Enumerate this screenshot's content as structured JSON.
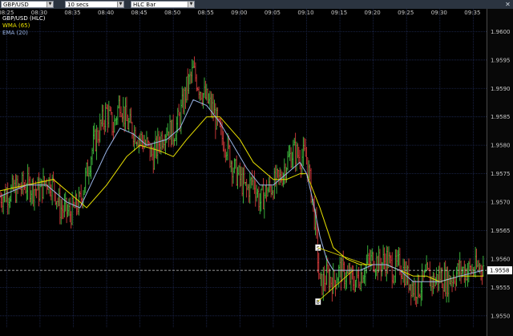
{
  "toolbar": {
    "symbol": "GBP/USD",
    "interval": "10 secs",
    "chart_style": "HLC Bar"
  },
  "colors": {
    "background": "#000000",
    "grid": "#1f2a55",
    "up": "#3fbf3f",
    "down": "#d23a3a",
    "wma": "#e8e000",
    "ema": "#9bb6e8",
    "axis_text": "#c8c8c8",
    "price_line": "#c8c8c8"
  },
  "chart_data": {
    "type": "line",
    "legend": [
      {
        "label": "GBP/USD (HLC)",
        "color": "#ffffff"
      },
      {
        "label": "WMA (65)",
        "color": "#e8e000"
      },
      {
        "label": "EMA (20)",
        "color": "#9bb6e8"
      }
    ],
    "time_ticks": [
      "08:25",
      "08:30",
      "08:35",
      "08:40",
      "08:45",
      "08:50",
      "08:55",
      "09:00",
      "09:05",
      "09:10",
      "09:15",
      "09:20",
      "09:25",
      "09:30",
      "09:35"
    ],
    "price_ticks": [
      "1.9600",
      "1.9595",
      "1.9590",
      "1.9585",
      "1.9580",
      "1.9575",
      "1.9570",
      "1.9565",
      "1.9560",
      "1.9555",
      "1.9550"
    ],
    "ylim": [
      1.9548,
      1.9604
    ],
    "current_price": 1.9558,
    "current_price_label": "1.9558",
    "grid": true,
    "markers": [
      {
        "label": "S",
        "time": "09:11:40",
        "price": 1.9562
      },
      {
        "label": "B",
        "time": "09:11:40",
        "price": 1.95525
      }
    ],
    "price_path": [
      [
        "08:24:00",
        1.9571
      ],
      [
        "08:26:00",
        1.9572
      ],
      [
        "08:28:00",
        1.9573
      ],
      [
        "08:30:00",
        1.9572
      ],
      [
        "08:31:00",
        1.9574
      ],
      [
        "08:32:00",
        1.9573
      ],
      [
        "08:33:00",
        1.9569
      ],
      [
        "08:34:30",
        1.9568
      ],
      [
        "08:36:00",
        1.957
      ],
      [
        "08:37:00",
        1.9575
      ],
      [
        "08:38:00",
        1.958
      ],
      [
        "08:39:00",
        1.9583
      ],
      [
        "08:40:00",
        1.9586
      ],
      [
        "08:41:00",
        1.9583
      ],
      [
        "08:42:00",
        1.9588
      ],
      [
        "08:43:00",
        1.9584
      ],
      [
        "08:44:30",
        1.9582
      ],
      [
        "08:46:00",
        1.958
      ],
      [
        "08:47:00",
        1.9578
      ],
      [
        "08:48:00",
        1.9581
      ],
      [
        "08:49:00",
        1.9583
      ],
      [
        "08:50:00",
        1.9582
      ],
      [
        "08:51:00",
        1.9585
      ],
      [
        "08:52:00",
        1.959
      ],
      [
        "08:53:00",
        1.9593
      ],
      [
        "08:54:00",
        1.959
      ],
      [
        "08:55:00",
        1.9588
      ],
      [
        "08:56:00",
        1.9586
      ],
      [
        "08:57:00",
        1.9582
      ],
      [
        "08:58:00",
        1.958
      ],
      [
        "08:59:00",
        1.9576
      ],
      [
        "09:00:00",
        1.9574
      ],
      [
        "09:01:00",
        1.9572
      ],
      [
        "09:02:00",
        1.9574
      ],
      [
        "09:03:00",
        1.957
      ],
      [
        "09:04:00",
        1.9572
      ],
      [
        "09:05:00",
        1.9573
      ],
      [
        "09:06:00",
        1.9574
      ],
      [
        "09:07:00",
        1.9577
      ],
      [
        "09:08:00",
        1.9579
      ],
      [
        "09:09:00",
        1.9578
      ],
      [
        "09:10:00",
        1.9578
      ],
      [
        "09:10:40",
        1.9572
      ],
      [
        "09:11:20",
        1.9566
      ],
      [
        "09:12:00",
        1.9555
      ],
      [
        "09:13:00",
        1.9557
      ],
      [
        "09:14:00",
        1.9556
      ],
      [
        "09:15:00",
        1.9558
      ],
      [
        "09:16:00",
        1.9557
      ],
      [
        "09:17:00",
        1.9556
      ],
      [
        "09:18:00",
        1.9557
      ],
      [
        "09:19:00",
        1.9559
      ],
      [
        "09:20:00",
        1.956
      ],
      [
        "09:21:00",
        1.9559
      ],
      [
        "09:22:00",
        1.956
      ],
      [
        "09:23:00",
        1.9558
      ],
      [
        "09:24:00",
        1.9559
      ],
      [
        "09:25:00",
        1.9557
      ],
      [
        "09:26:00",
        1.9555
      ],
      [
        "09:27:00",
        1.9555
      ],
      [
        "09:28:00",
        1.9557
      ],
      [
        "09:29:00",
        1.9556
      ],
      [
        "09:30:00",
        1.9557
      ],
      [
        "09:31:00",
        1.9556
      ],
      [
        "09:32:00",
        1.9557
      ],
      [
        "09:33:00",
        1.9558
      ],
      [
        "09:34:00",
        1.9558
      ],
      [
        "09:35:00",
        1.9558
      ],
      [
        "09:36:30",
        1.9559
      ]
    ],
    "series": [
      {
        "name": "WMA (65)",
        "color": "#e8e000",
        "points": [
          [
            "08:24:00",
            1.9572
          ],
          [
            "08:28:00",
            1.9573
          ],
          [
            "08:32:00",
            1.9574
          ],
          [
            "08:35:00",
            1.9571
          ],
          [
            "08:37:00",
            1.9569
          ],
          [
            "08:40:00",
            1.9573
          ],
          [
            "08:43:00",
            1.9578
          ],
          [
            "08:45:00",
            1.958
          ],
          [
            "08:48:00",
            1.9579
          ],
          [
            "08:50:00",
            1.9578
          ],
          [
            "08:52:00",
            1.9581
          ],
          [
            "08:55:00",
            1.9585
          ],
          [
            "08:57:00",
            1.9585
          ],
          [
            "09:00:00",
            1.9581
          ],
          [
            "09:02:00",
            1.9577
          ],
          [
            "09:05:00",
            1.9574
          ],
          [
            "09:07:00",
            1.9574
          ],
          [
            "09:09:00",
            1.9575
          ],
          [
            "09:10:00",
            1.9575
          ],
          [
            "09:12:00",
            1.9569
          ],
          [
            "09:14:00",
            1.9562
          ],
          [
            "09:16:00",
            1.956
          ],
          [
            "09:18:00",
            1.9559
          ],
          [
            "09:20:00",
            1.9559
          ],
          [
            "09:22:00",
            1.9559
          ],
          [
            "09:24:00",
            1.9558
          ],
          [
            "09:26:00",
            1.9557
          ],
          [
            "09:28:00",
            1.9557
          ],
          [
            "09:30:00",
            1.9556
          ],
          [
            "09:33:00",
            1.9557
          ],
          [
            "09:36:30",
            1.9557
          ]
        ]
      },
      {
        "name": "EMA (20)",
        "color": "#9bb6e8",
        "points": [
          [
            "08:24:00",
            1.9571
          ],
          [
            "08:28:00",
            1.9573
          ],
          [
            "08:31:00",
            1.9573
          ],
          [
            "08:34:00",
            1.957
          ],
          [
            "08:36:00",
            1.9569
          ],
          [
            "08:38:00",
            1.9574
          ],
          [
            "08:40:00",
            1.9579
          ],
          [
            "08:42:00",
            1.9583
          ],
          [
            "08:44:00",
            1.9582
          ],
          [
            "08:46:00",
            1.958
          ],
          [
            "08:49:00",
            1.9581
          ],
          [
            "08:51:00",
            1.9583
          ],
          [
            "08:53:00",
            1.9588
          ],
          [
            "08:55:00",
            1.9587
          ],
          [
            "08:57:00",
            1.9584
          ],
          [
            "08:59:00",
            1.958
          ],
          [
            "09:01:00",
            1.9576
          ],
          [
            "09:03:00",
            1.9573
          ],
          [
            "09:05:00",
            1.9573
          ],
          [
            "09:07:00",
            1.9575
          ],
          [
            "09:09:00",
            1.9577
          ],
          [
            "09:10:00",
            1.9575
          ],
          [
            "09:11:00",
            1.957
          ],
          [
            "09:12:00",
            1.9564
          ],
          [
            "09:13:00",
            1.956
          ],
          [
            "09:14:00",
            1.9558
          ],
          [
            "09:16:00",
            1.9558
          ],
          [
            "09:18:00",
            1.9558
          ],
          [
            "09:20:00",
            1.9559
          ],
          [
            "09:22:00",
            1.9559
          ],
          [
            "09:24:00",
            1.9558
          ],
          [
            "09:26:00",
            1.9556
          ],
          [
            "09:28:00",
            1.9556
          ],
          [
            "09:30:00",
            1.9556
          ],
          [
            "09:33:00",
            1.9557
          ],
          [
            "09:36:30",
            1.9558
          ]
        ]
      }
    ]
  }
}
